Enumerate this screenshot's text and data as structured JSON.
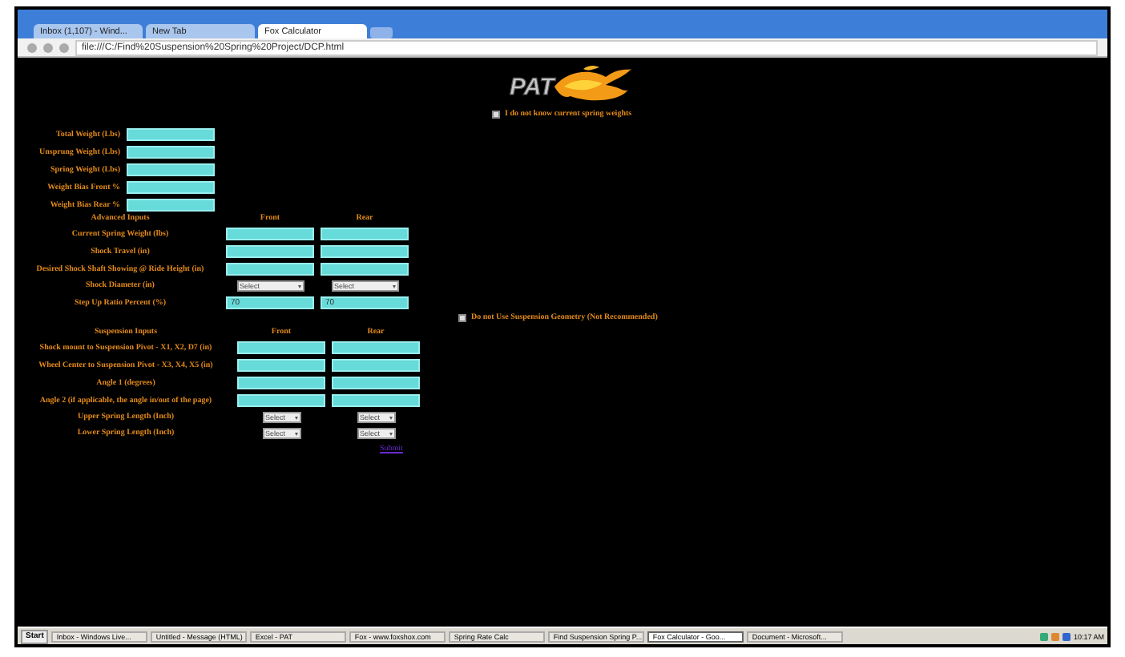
{
  "browser": {
    "tabs": [
      {
        "label": "Inbox (1,107) - Wind...",
        "selected": false
      },
      {
        "label": "New Tab",
        "selected": false
      },
      {
        "label": "Fox Calculator",
        "selected": true
      }
    ],
    "address": "file:///C:/Find%20Suspension%20Spring%20Project/DCP.html"
  },
  "page": {
    "logo": "PAT",
    "spring_weights_checkbox": {
      "label": "I do not know current spring weights",
      "checked": false
    },
    "basic_inputs": [
      {
        "label": "Total Weight (Lbs)"
      },
      {
        "label": "Unsprung Weight (Lbs)"
      },
      {
        "label": "Spring Weight (Lbs)"
      },
      {
        "label": "Weight Bias Front %"
      },
      {
        "label": "Weight Bias Rear %"
      }
    ],
    "shock_inputs": {
      "heading": "Advanced Inputs",
      "columns": [
        "Front",
        "Rear"
      ],
      "rows": [
        {
          "label": "Current Spring Weight (lbs)",
          "kind": "input"
        },
        {
          "label": "Shock Travel (in)",
          "kind": "input"
        },
        {
          "label": "Desired Shock Shaft Showing @ Ride Height (in)",
          "kind": "input"
        },
        {
          "label": "Shock Diameter (in)",
          "kind": "select",
          "front": "Select",
          "rear": "Select"
        },
        {
          "label": "Step Up Ratio Percent (%)",
          "kind": "input",
          "front": "70",
          "rear": "70"
        }
      ]
    },
    "geometry_checkbox": {
      "label": "Do not Use Suspension Geometry (Not Recommended)",
      "checked": false
    },
    "suspension_inputs": {
      "heading": "Suspension Inputs",
      "columns": [
        "Front",
        "Rear"
      ],
      "rows": [
        {
          "label": "Shock mount to Suspension Pivot - X1, X2, D7 (in)",
          "kind": "input"
        },
        {
          "label": "Wheel Center to Suspension Pivot - X3, X4, X5 (in)",
          "kind": "input"
        },
        {
          "label": "Angle 1 (degrees)",
          "kind": "input"
        },
        {
          "label": "Angle 2 (if applicable, the angle in/out of the page)",
          "kind": "input"
        },
        {
          "label": "Upper Spring Length (Inch)",
          "kind": "select",
          "front": "Select",
          "rear": "Select"
        },
        {
          "label": "Lower Spring Length (Inch)",
          "kind": "select",
          "front": "Select",
          "rear": "Select"
        }
      ]
    },
    "submit_link": "Submit"
  },
  "taskbar": {
    "start": "Start",
    "items": [
      {
        "label": "Inbox - Windows Live...",
        "selected": false
      },
      {
        "label": "Untitled - Message (HTML)",
        "selected": false
      },
      {
        "label": "Excel - PAT",
        "selected": false
      },
      {
        "label": "Fox - www.foxshox.com",
        "selected": false
      },
      {
        "label": "Spring Rate Calc",
        "selected": false
      },
      {
        "label": "Find Suspension Spring P...",
        "selected": false
      },
      {
        "label": "Fox Calculator - Goo...",
        "selected": true
      },
      {
        "label": "Document - Microsoft...",
        "selected": false
      }
    ],
    "clock": "10:17 AM"
  }
}
